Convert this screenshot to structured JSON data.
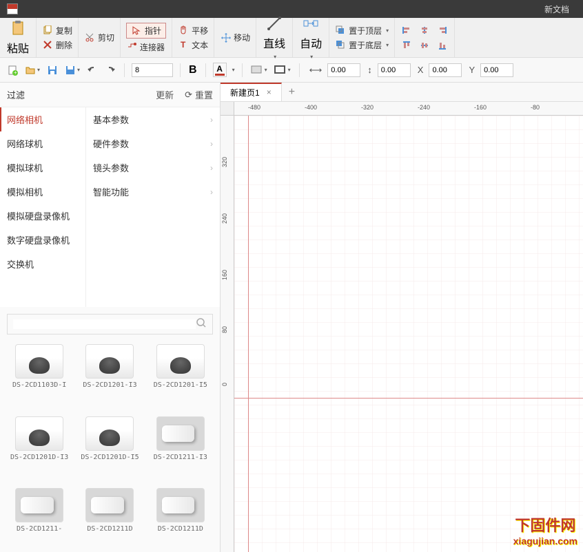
{
  "titlebar": {
    "doc_title": "新文档"
  },
  "ribbon": {
    "paste": "粘贴",
    "copy": "复制",
    "cut": "剪切",
    "delete": "删除",
    "pointer": "指针",
    "connector": "连接器",
    "pan": "平移",
    "text": "文本",
    "move": "移动",
    "line": "直线",
    "auto": "自动",
    "bring_front": "置于顶层",
    "send_back": "置于底层"
  },
  "toolbar": {
    "font_size": "8",
    "h_val": "0.00",
    "v_val": "0.00",
    "x_val": "0.00",
    "y_val": "0.00"
  },
  "filter": {
    "label": "过滤",
    "update": "更新",
    "reset": "重置"
  },
  "categories_left": [
    "网络相机",
    "网络球机",
    "模拟球机",
    "模拟相机",
    "模拟硬盘录像机",
    "数字硬盘录像机",
    "交换机"
  ],
  "categories_right": [
    "基本参数",
    "硬件参数",
    "镜头参数",
    "智能功能"
  ],
  "search": {
    "placeholder": ""
  },
  "gallery": [
    {
      "label": "DS-2CD1103D-I",
      "type": "dome"
    },
    {
      "label": "DS-2CD1201-I3",
      "type": "dome"
    },
    {
      "label": "DS-2CD1201-I5",
      "type": "dome"
    },
    {
      "label": "DS-2CD1201D-I3",
      "type": "dome"
    },
    {
      "label": "DS-2CD1201D-I5",
      "type": "dome"
    },
    {
      "label": "DS-2CD1211-I3",
      "type": "bullet"
    },
    {
      "label": "DS-2CD1211-",
      "type": "bullet"
    },
    {
      "label": "DS-2CD1211D",
      "type": "bullet"
    },
    {
      "label": "DS-2CD1211D",
      "type": "bullet"
    }
  ],
  "tab": {
    "name": "新建页1"
  },
  "ruler_h": [
    -480,
    -400,
    -320,
    -240,
    -160,
    -80
  ],
  "ruler_v": [
    320,
    240,
    160,
    80,
    0
  ],
  "watermark": {
    "big": "下固件网",
    "url": "xiagujian.com"
  }
}
